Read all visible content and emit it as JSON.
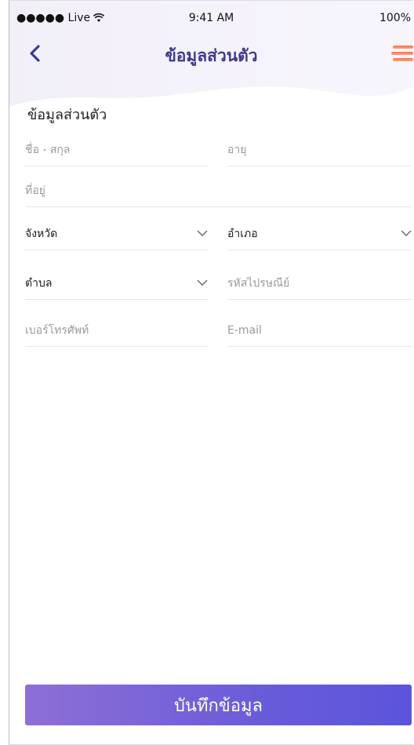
{
  "status_bar": {
    "carrier": "●●●●● Live",
    "time": "9:41 AM",
    "battery": "100%"
  },
  "nav": {
    "title": "ข้อมูลส่วนตัว"
  },
  "form": {
    "section_title": "ข้อมูลส่วนตัว",
    "name_placeholder": "ชื่อ - สกุล",
    "age_placeholder": "อายุ",
    "address_placeholder": "ที่อยู่",
    "province_label": "จังหวัด",
    "district_label": "อำเภอ",
    "subdistrict_label": "ตำบล",
    "postcode_placeholder": "รหัสไปรษณีย์",
    "phone_placeholder": "เบอร์โทรศัพท์",
    "email_placeholder": "E-mail"
  },
  "save_button": {
    "label": "บันทึกข้อมูล"
  },
  "colors": {
    "title": "#3d3a8c",
    "button_start": "#8e6fd6",
    "button_end": "#5b54db",
    "menu_top": "#ff6b6b",
    "menu_bottom": "#ffa94d"
  }
}
